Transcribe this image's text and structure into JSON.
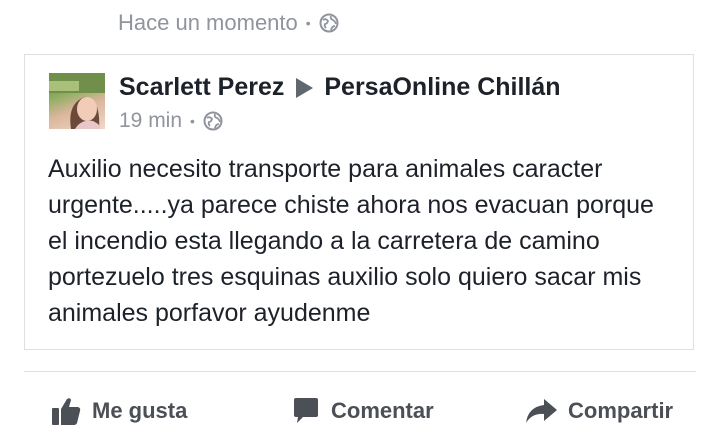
{
  "header": {
    "timestamp": "Hace un momento",
    "separator": "•",
    "privacy_icon": "globe-icon"
  },
  "shared_post": {
    "author": "Scarlett Perez",
    "target_icon": "triangle-right-icon",
    "target_page": "PersaOnline Chillán",
    "timestamp": "19 min",
    "separator": "•",
    "privacy_icon": "globe-icon",
    "text": "Auxilio necesito transporte para animales caracter urgente.....ya parece chiste ahora nos evacuan porque el incendio esta llegando a la carretera de camino portezuelo tres esquinas auxilio solo quiero sacar mis animales porfavor ayudenme"
  },
  "actions": {
    "like": {
      "label": "Me gusta",
      "icon": "thumbs-up-icon"
    },
    "comment": {
      "label": "Comentar",
      "icon": "comment-icon"
    },
    "share": {
      "label": "Compartir",
      "icon": "share-arrow-icon"
    }
  },
  "colors": {
    "text": "#1d2129",
    "muted": "#90949c",
    "action": "#4b4f56",
    "border": "#dddfe2"
  }
}
